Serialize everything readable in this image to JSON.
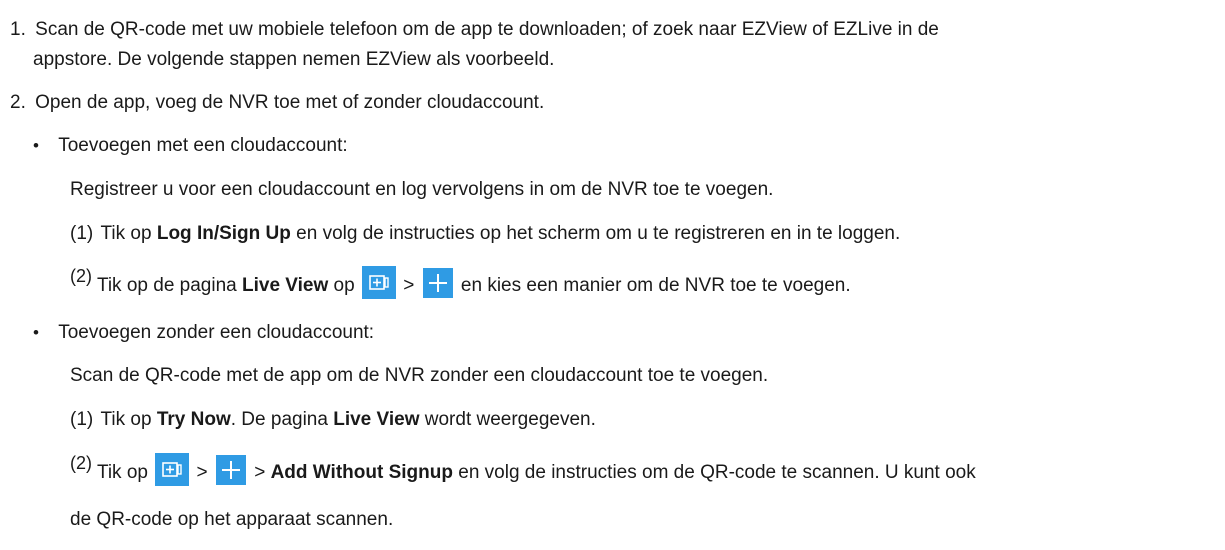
{
  "step1": {
    "number": "1.",
    "text_line1": "Scan de QR-code met uw mobiele telefoon om de app te downloaden; of zoek naar EZView of EZLive in de",
    "text_line2": "appstore. De volgende stappen nemen EZView als voorbeeld."
  },
  "step2": {
    "number": "2.",
    "text": "Open de app, voeg de NVR toe met of zonder cloudaccount."
  },
  "with_cloud": {
    "bullet": "•",
    "heading": "Toevoegen met een cloudaccount:",
    "intro": "Registreer u voor een cloudaccount en log vervolgens in om de NVR toe te voegen.",
    "sub1": {
      "number": "(1)",
      "pre": "Tik op ",
      "bold": "Log In/Sign Up",
      "post": " en volg de instructies op het scherm om u te registreren en in te loggen."
    },
    "sub2": {
      "number": "(2)",
      "pre": "Tik op de pagina ",
      "bold": "Live View",
      "mid": " op ",
      "sep": " > ",
      "post": " en kies een manier om de NVR toe te voegen."
    }
  },
  "without_cloud": {
    "bullet": "•",
    "heading": "Toevoegen zonder een cloudaccount:",
    "intro": "Scan de QR-code met de app om de NVR zonder een cloudaccount toe te voegen.",
    "sub1": {
      "number": "(1)",
      "pre": "Tik op ",
      "bold1": "Try Now",
      "mid": ". De pagina ",
      "bold2": "Live View",
      "post": " wordt weergegeven."
    },
    "sub2": {
      "number": "(2)",
      "pre": "Tik op ",
      "sep1": " > ",
      "sep2": " > ",
      "bold": "Add Without Signup",
      "post_line1": " en volg de instructies om de QR-code te scannen. U kunt ook",
      "post_line2": "de QR-code op het apparaat scannen."
    }
  },
  "icons": {
    "add_device": "add-device-icon",
    "plus": "plus-icon",
    "accent_color": "#2f9be4"
  }
}
